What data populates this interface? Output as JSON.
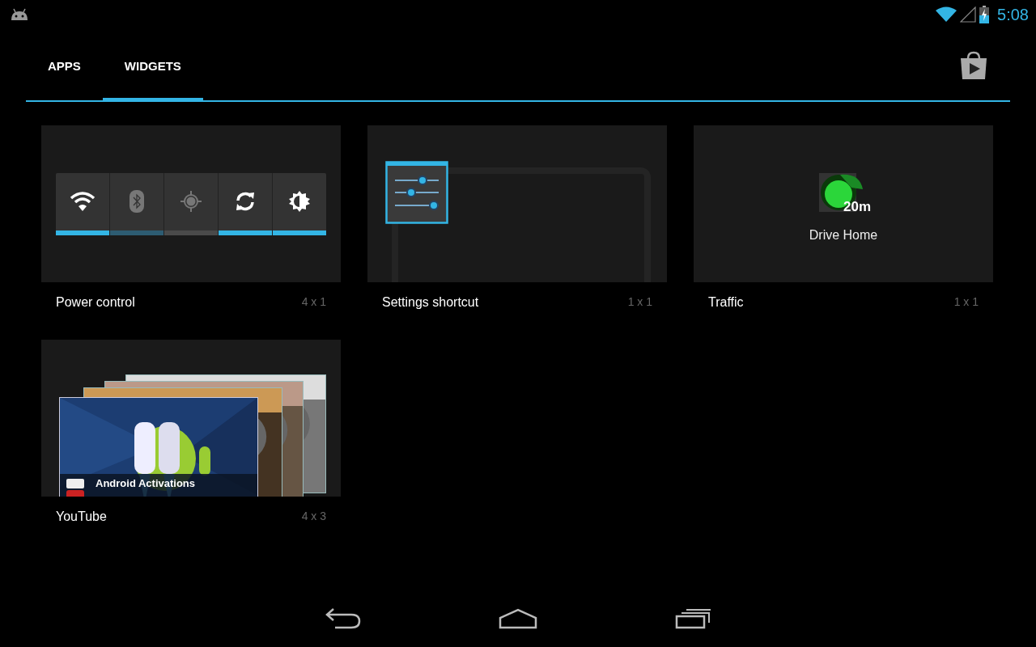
{
  "status_bar": {
    "time": "5:08"
  },
  "tabs": [
    {
      "label": "APPS",
      "selected": false
    },
    {
      "label": "WIDGETS",
      "selected": true
    }
  ],
  "widgets": [
    {
      "kind": "power",
      "name": "Power control",
      "size": "4 x 1",
      "toggles": [
        {
          "kind": "wifi",
          "on": true,
          "pending": false
        },
        {
          "kind": "bluetooth",
          "on": false,
          "pending": true
        },
        {
          "kind": "gps",
          "on": false,
          "pending": false
        },
        {
          "kind": "sync",
          "on": true,
          "pending": false
        },
        {
          "kind": "brightness",
          "on": true,
          "pending": false
        }
      ]
    },
    {
      "kind": "settings",
      "name": "Settings shortcut",
      "size": "1 x 1"
    },
    {
      "kind": "traffic",
      "name": "Traffic",
      "size": "1 x 1",
      "badge": "20m",
      "caption": "Drive Home"
    },
    {
      "kind": "youtube",
      "name": "YouTube",
      "size": "4 x 3",
      "video_title": "Android Activations"
    }
  ]
}
